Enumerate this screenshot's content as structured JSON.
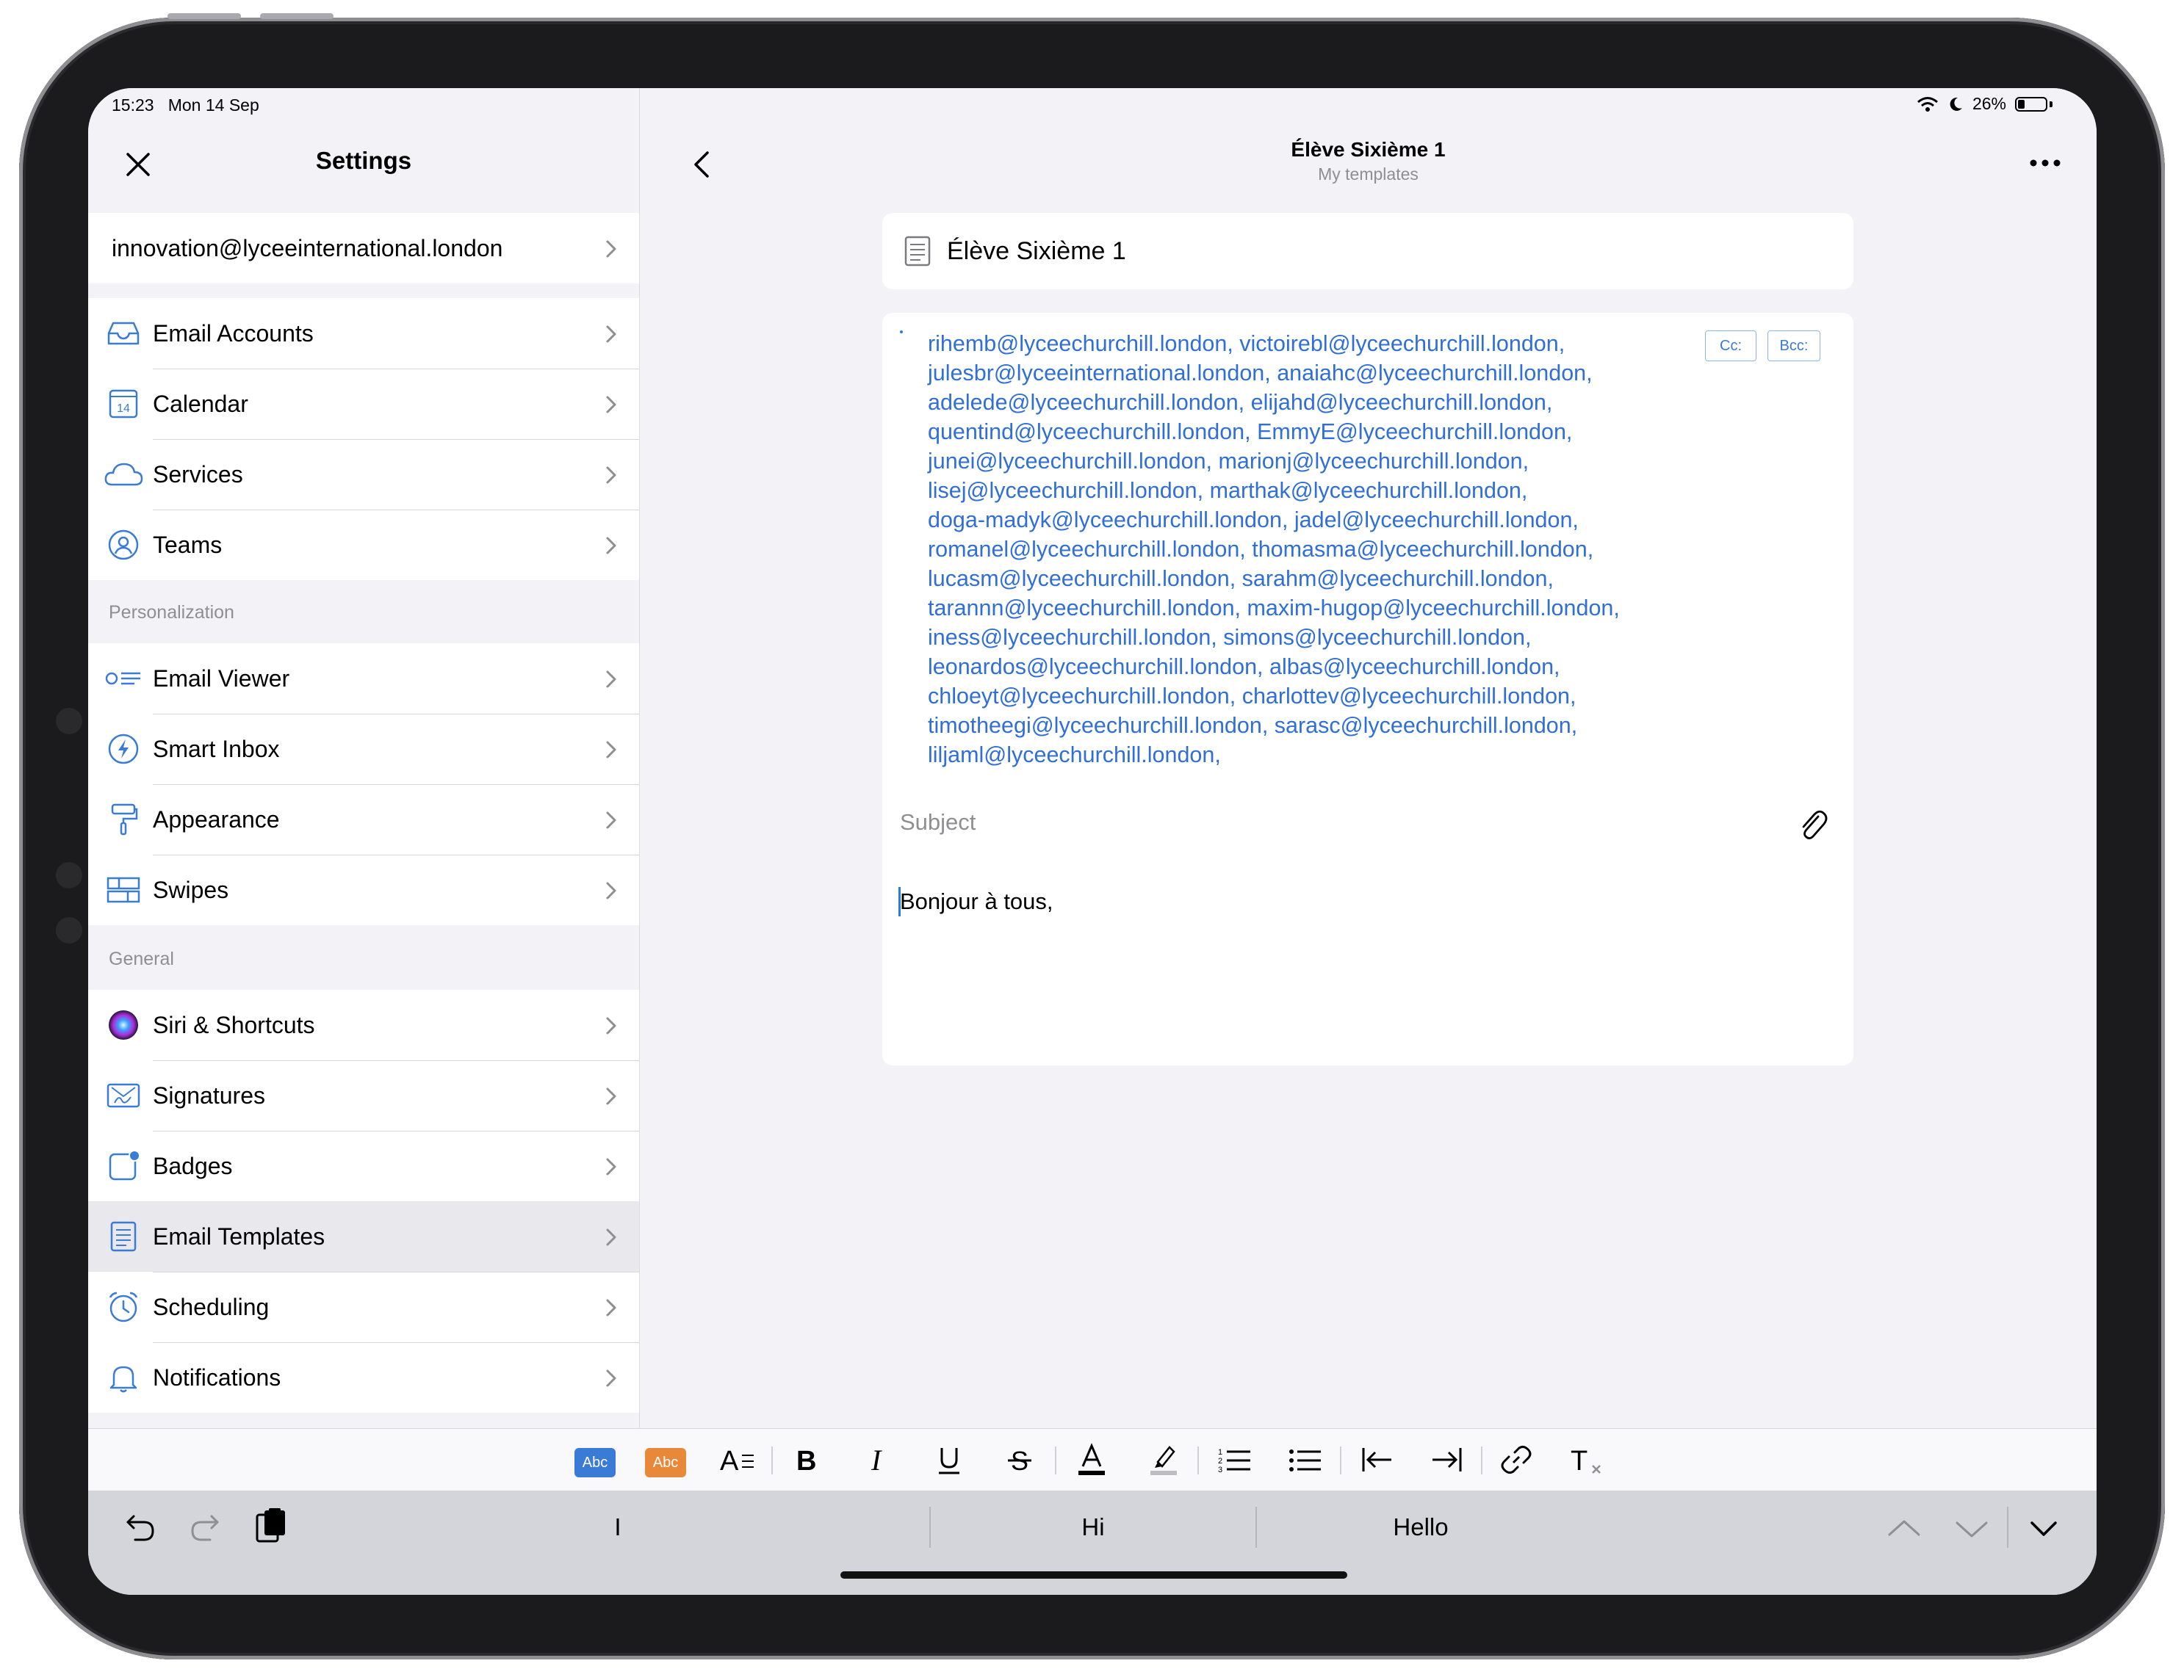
{
  "status_bar": {
    "time": "15:23",
    "date": "Mon 14 Sep",
    "battery": "26%",
    "battery_level": 0.26
  },
  "sidebar": {
    "title": "Settings",
    "account": "innovation@lyceeinternational.london",
    "group1": [
      {
        "label": "Email Accounts",
        "icon": "inbox-tray-icon"
      },
      {
        "label": "Calendar",
        "icon": "calendar-icon",
        "icon_text": "14"
      },
      {
        "label": "Services",
        "icon": "cloud-icon"
      },
      {
        "label": "Teams",
        "icon": "person-circle-icon"
      }
    ],
    "section_personalization": "Personalization",
    "group2": [
      {
        "label": "Email Viewer",
        "icon": "list-view-icon"
      },
      {
        "label": "Smart Inbox",
        "icon": "lightning-icon"
      },
      {
        "label": "Appearance",
        "icon": "paint-roller-icon"
      },
      {
        "label": "Swipes",
        "icon": "swipes-grid-icon"
      }
    ],
    "section_general": "General",
    "group3": [
      {
        "label": "Siri & Shortcuts",
        "icon": "siri-icon"
      },
      {
        "label": "Signatures",
        "icon": "signature-icon"
      },
      {
        "label": "Badges",
        "icon": "badge-icon"
      },
      {
        "label": "Email Templates",
        "icon": "template-document-icon",
        "selected": true
      },
      {
        "label": "Scheduling",
        "icon": "alarm-clock-icon"
      },
      {
        "label": "Notifications",
        "icon": "bell-icon"
      }
    ]
  },
  "main": {
    "nav_title": "Élève Sixième 1",
    "nav_subtitle": "My templates",
    "template_name": "Élève Sixième 1",
    "recipients": [
      "rihemb@lyceechurchill.london,",
      "victoirebl@lyceechurchill.london,",
      "julesbr@lyceeinternational.london,",
      "anaiahc@lyceechurchill.london,",
      "adelede@lyceechurchill.london,",
      "elijahd@lyceechurchill.london,",
      "quentind@lyceechurchill.london,",
      "EmmyE@lyceechurchill.london,",
      "junei@lyceechurchill.london,",
      "marionj@lyceechurchill.london,",
      "lisej@lyceechurchill.london,",
      "marthak@lyceechurchill.london,",
      "doga-madyk@lyceechurchill.london,",
      "jadel@lyceechurchill.london,",
      "romanel@lyceechurchill.london,",
      "thomasma@lyceechurchill.london,",
      "lucasm@lyceechurchill.london,",
      "sarahm@lyceechurchill.london,",
      "tarannn@lyceechurchill.london,",
      "maxim-hugop@lyceechurchill.london,",
      "iness@lyceechurchill.london,",
      "simons@lyceechurchill.london,",
      "leonardos@lyceechurchill.london,",
      "albas@lyceechurchill.london,",
      "chloeyt@lyceechurchill.london,",
      "charlottev@lyceechurchill.london,",
      "timotheegi@lyceechurchill.london,",
      "sarasc@lyceechurchill.london,",
      "liljaml@lyceechurchill.london,"
    ],
    "cc_label": "Cc:",
    "bcc_label": "Bcc:",
    "subject_placeholder": "Subject",
    "body": "Bonjour à tous,"
  },
  "toolbar": {
    "abc_blue": "Abc",
    "abc_orange": "Abc",
    "accent_blue": "#3a7bd5",
    "accent_orange": "#e8893a"
  },
  "keyboard": {
    "suggestions": [
      "I",
      "Hi",
      "Hello"
    ]
  }
}
